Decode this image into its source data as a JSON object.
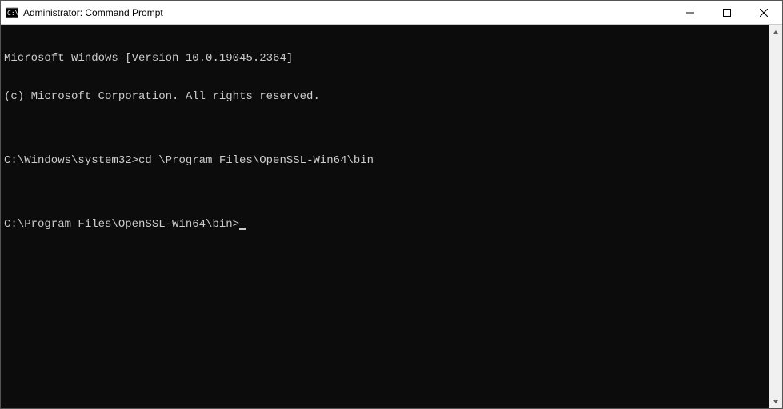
{
  "window": {
    "title": "Administrator: Command Prompt"
  },
  "terminal": {
    "line1": "Microsoft Windows [Version 10.0.19045.2364]",
    "line2": "(c) Microsoft Corporation. All rights reserved.",
    "blank1": "",
    "prompt1": "C:\\Windows\\system32>",
    "command1": "cd \\Program Files\\OpenSSL-Win64\\bin",
    "blank2": "",
    "prompt2": "C:\\Program Files\\OpenSSL-Win64\\bin>"
  }
}
